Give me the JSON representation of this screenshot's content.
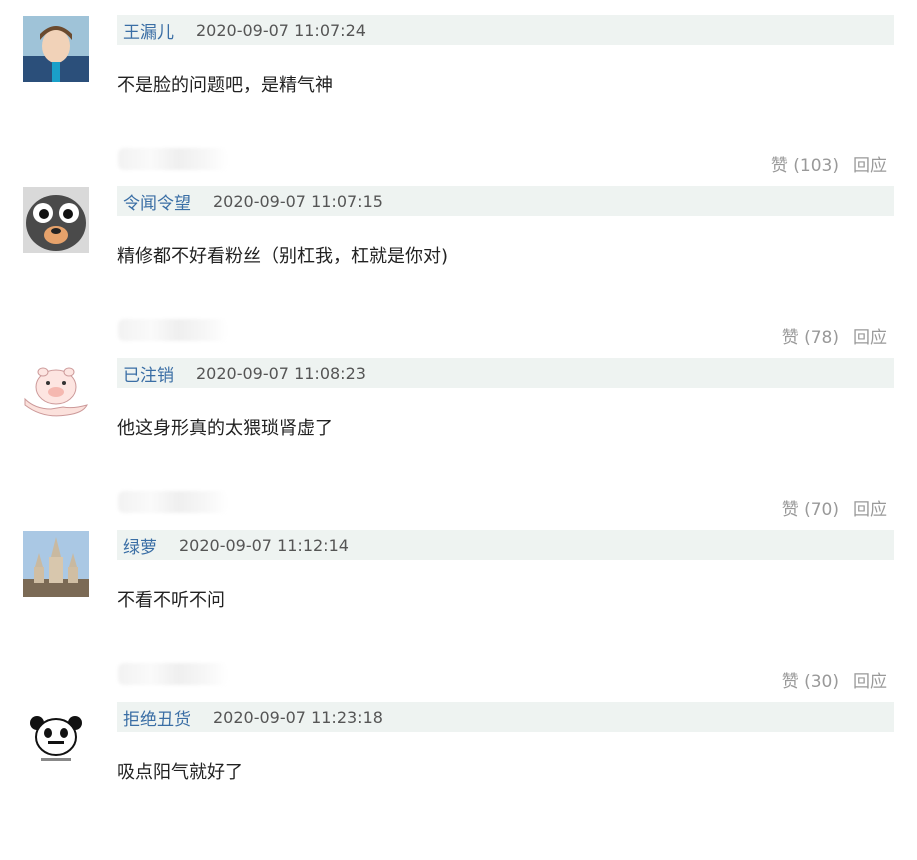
{
  "comments": [
    {
      "author": "王漏儿",
      "time": "2020-09-07 11:07:24",
      "text": "不是脸的问题吧，是精气神",
      "like_label": "赞 (103)",
      "reply_label": "回应",
      "avatar": "person-avatar"
    },
    {
      "author": "令闻令望",
      "time": "2020-09-07 11:07:15",
      "text": "精修都不好看粉丝（别杠我，杠就是你对)",
      "like_label": "赞 (78)",
      "reply_label": "回应",
      "avatar": "cartoon-animal-avatar"
    },
    {
      "author": "已注销",
      "time": "2020-09-07 11:08:23",
      "text": "他这身形真的太猥琐肾虚了",
      "like_label": "赞 (70)",
      "reply_label": "回应",
      "avatar": "pig-hand-avatar"
    },
    {
      "author": "绿萝",
      "time": "2020-09-07 11:12:14",
      "text": "不看不听不问",
      "like_label": "赞 (30)",
      "reply_label": "回应",
      "avatar": "castle-avatar"
    },
    {
      "author": "拒绝丑货",
      "time": "2020-09-07 11:23:18",
      "text": "吸点阳气就好了",
      "like_label": "",
      "reply_label": "",
      "avatar": "panda-meme-avatar"
    }
  ],
  "colors": {
    "author": "#3a6ea5",
    "header_bg": "#eef3f1",
    "muted": "#999999"
  }
}
